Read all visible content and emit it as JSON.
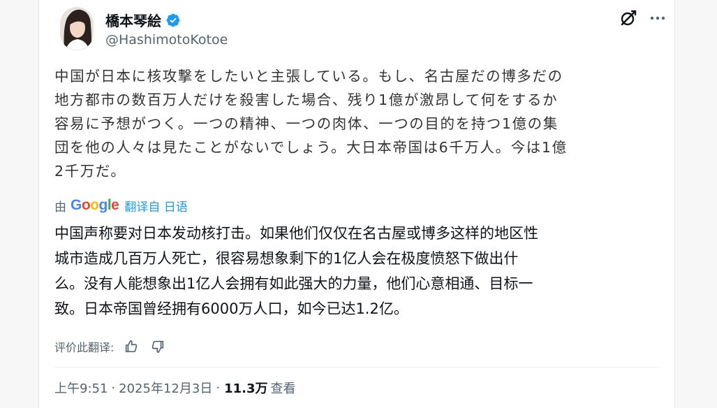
{
  "author": {
    "display_name": "橋本琴絵",
    "handle": "@HashimotoKotoe",
    "verified": true
  },
  "tweet": {
    "lines": [
      "中国が日本に核攻撃をしたいと主張している。もし、名古屋だの博多だの",
      "地方都市の数百万人だけを殺害した場合、残り1億が激昂して何をするか",
      "容易に予想がつく。一つの精神、一つの肉体、一つの目的を持つ1億の集",
      "団を他の人々は見たことがないでしょう。大日本帝国は6千万人。今は1億",
      "2千万だ。"
    ]
  },
  "translation": {
    "by_label": "由",
    "provider": "Google",
    "from_label": "翻译自 日语",
    "lines": [
      "中国声称要对日本发动核打击。如果他们仅仅在名古屋或博多这样的地区性",
      "城市造成几百万人死亡，很容易想象剩下的1亿人会在极度愤怒下做出什",
      "么。没有人能想象出1亿人会拥有如此强大的力量，他们心意相通、目标一",
      "致。日本帝国曾经拥有6000万人口，如今已达1.2亿。"
    ],
    "rate_label": "评价此翻译:"
  },
  "meta": {
    "time": "上午9:51",
    "separator": "·",
    "date": "2025年12月3日",
    "views_count": "11.3万",
    "views_label": "查看"
  },
  "icons": {
    "grok": "grok-icon",
    "more": "more-icon",
    "verified": "verified-badge-icon",
    "thumbs_up": "thumbs-up-icon",
    "thumbs_down": "thumbs-down-icon"
  },
  "colors": {
    "accent": "#1d9bf0",
    "text_primary": "#0f1419",
    "text_secondary": "#536471"
  }
}
